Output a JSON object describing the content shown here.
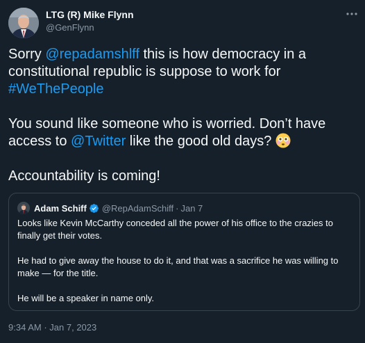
{
  "tweet": {
    "author_name": "LTG (R) Mike Flynn",
    "author_handle": "@GenFlynn",
    "line1_a": "Sorry ",
    "mention1": "@repadamshlff",
    "line1_b": " this is how democracy in a constitutional republic is suppose to work for ",
    "hashtag": "#WeThePeople",
    "line2_a": "You sound like someone who is worried. Don’t have access to ",
    "mention2": "@Twitter",
    "line2_b": " like the good old days? ",
    "emoji": "flushed-face-emoji",
    "line3": "Accountability is coming!",
    "time": "9:34 AM",
    "separator": "·",
    "date": "Jan 7, 2023"
  },
  "quoted_tweet": {
    "author_name": "Adam Schiff",
    "author_handle": "@RepAdamSchiff",
    "separator": "·",
    "date": "Jan 7",
    "para1": "Looks like Kevin McCarthy conceded all the power of his office to the crazies to finally get their votes.",
    "para2": "He had to give away the house to do it, and that was a sacrifice he was willing to make — for the title.",
    "para3": "He will be a speaker in name only."
  },
  "colors": {
    "background": "#15202b",
    "text": "#f7f9f9",
    "muted": "#8b98a5",
    "link": "#1d9bf0",
    "border": "#38444d"
  }
}
